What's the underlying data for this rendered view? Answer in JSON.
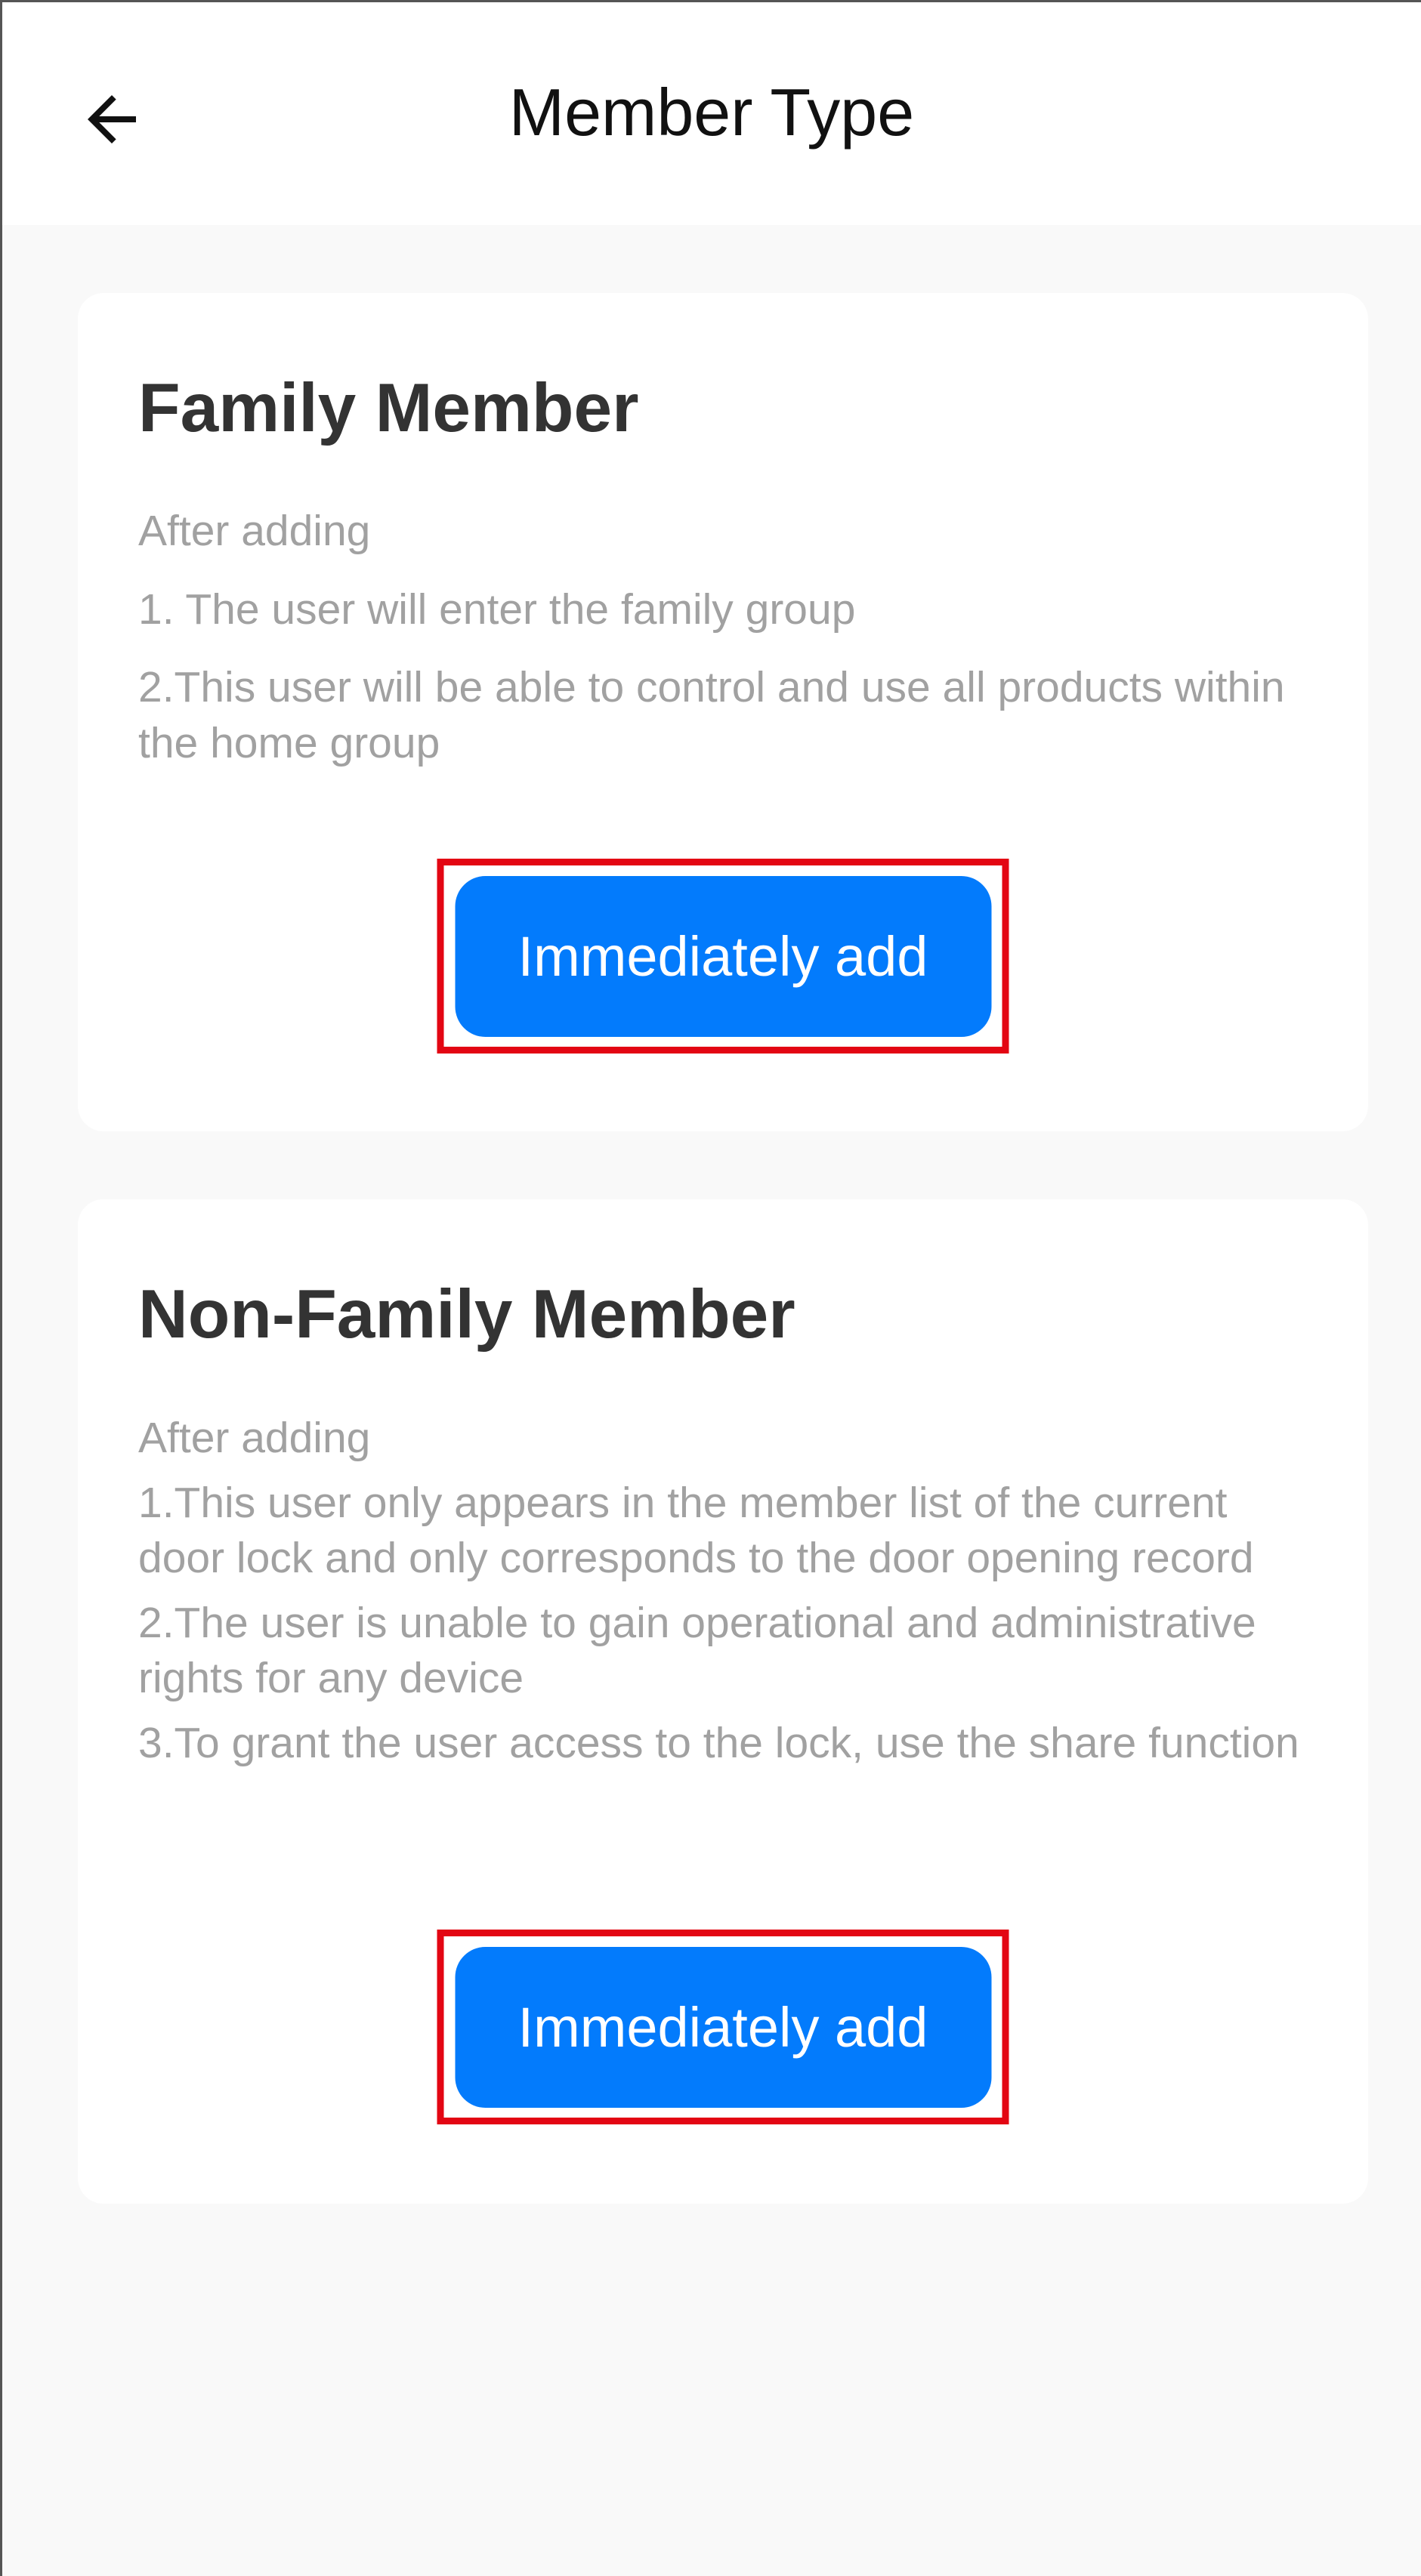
{
  "header": {
    "title": "Member Type",
    "back_icon": "arrow-left-icon"
  },
  "cards": [
    {
      "title": "Family Member",
      "intro": "After adding",
      "items": [
        "1. The user will enter the family group",
        "2.This user will be able to control and use all products within the home group"
      ],
      "button_label": "Immediately add"
    },
    {
      "title": "Non-Family Member",
      "intro": "After adding",
      "items": [
        "1.This user only appears in the member list of the current door lock and only corresponds to the door opening record",
        "2.The user is unable to gain operational and administrative rights for any device",
        "3.To grant the user access to the lock, use the share function"
      ],
      "button_label": "Immediately add"
    }
  ],
  "colors": {
    "primary_button": "#037bfc",
    "highlight_border": "#e30613",
    "description_text": "#a1a1a1",
    "title_text": "#333333",
    "page_background": "#f9f9f9"
  }
}
